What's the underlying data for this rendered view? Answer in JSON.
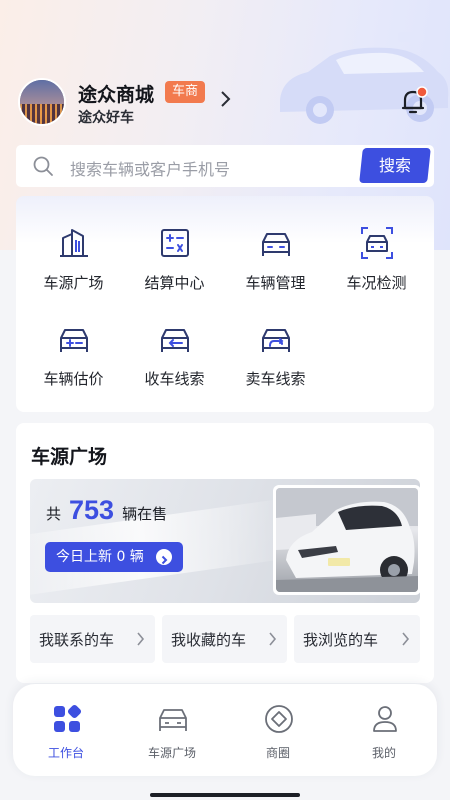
{
  "header": {
    "shop_name": "途众商城",
    "tag": "车商",
    "subtitle": "途众好车",
    "notification_dot": true
  },
  "search": {
    "placeholder": "搜索车辆或客户手机号",
    "button": "搜索"
  },
  "functions": [
    {
      "label": "车源广场",
      "icon": "building-icon"
    },
    {
      "label": "结算中心",
      "icon": "calculator-icon"
    },
    {
      "label": "车辆管理",
      "icon": "car-icon"
    },
    {
      "label": "车况检测",
      "icon": "car-scan-icon"
    },
    {
      "label": "车辆估价",
      "icon": "car-valuation-icon"
    },
    {
      "label": "收车线索",
      "icon": "car-inbound-icon"
    },
    {
      "label": "卖车线索",
      "icon": "car-outbound-icon"
    }
  ],
  "market": {
    "title": "车源广场",
    "count_prefix": "共",
    "count": "753",
    "count_suffix": "辆在售",
    "new_today": "今日上新 0 辆",
    "quick_links": [
      "我联系的车",
      "我收藏的车",
      "我浏览的车"
    ]
  },
  "tabbar": [
    {
      "label": "工作台",
      "icon": "grid-icon",
      "active": true
    },
    {
      "label": "车源广场",
      "icon": "car-icon",
      "active": false
    },
    {
      "label": "商圈",
      "icon": "diamond-circle-icon",
      "active": false
    },
    {
      "label": "我的",
      "icon": "person-icon",
      "active": false
    }
  ],
  "colors": {
    "accent": "#3d4fe0",
    "tag": "#f27a4e",
    "notification": "#f05a3c"
  }
}
